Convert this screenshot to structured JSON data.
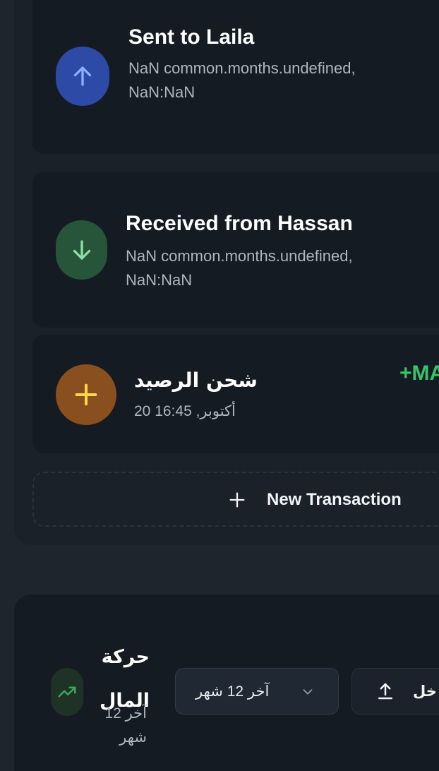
{
  "transactions": [
    {
      "title": "Sent to Laila",
      "subtitle": "NaN common.months.undefined, NaN:NaN",
      "icon": "arrow-up-icon",
      "icon_bg": "#2c4aa6",
      "icon_color": "#8fb0ff"
    },
    {
      "title": "Received from Hassan",
      "subtitle": "NaN common.months.undefined, NaN:NaN",
      "icon": "arrow-down-icon",
      "icon_bg": "#27553a",
      "icon_color": "#8fe0a6"
    },
    {
      "title": "شحن الرصيد",
      "subtitle": "20 أكتوبر, 16:45",
      "amount": "+MA",
      "amount_color": "#37c36a",
      "icon": "plus-icon",
      "icon_bg": "#8a4f1f",
      "icon_color": "#ffd54a"
    }
  ],
  "new_transaction": {
    "label": "New Transaction",
    "icon": "plus-icon"
  },
  "money_flow": {
    "title": "حركة المال",
    "subtitle": "آخر 12 شهر",
    "trend_icon": "trending-up-icon",
    "range_select": {
      "value": "آخر 12 شهر",
      "icon": "chevron-down-icon"
    },
    "export_button": {
      "label": "خل",
      "icon": "upload-icon"
    }
  }
}
